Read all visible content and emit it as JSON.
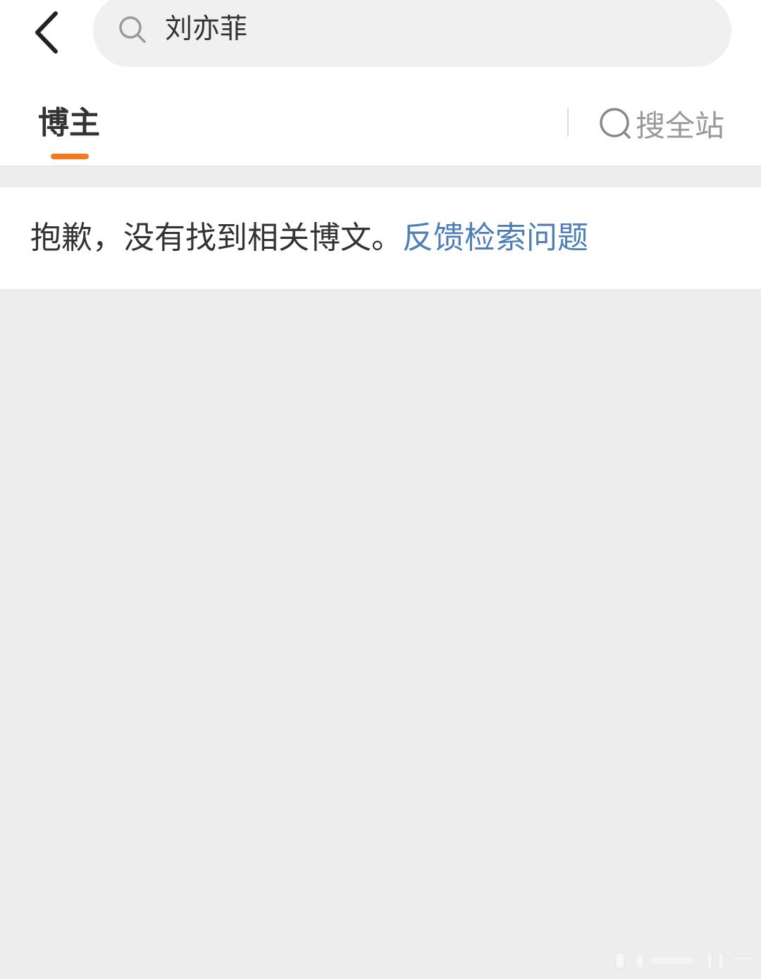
{
  "header": {
    "search_query": "刘亦菲"
  },
  "tabs": {
    "active_label": "博主",
    "search_all_label": "搜全站"
  },
  "notice": {
    "message": "抱歉，没有找到相关博文。",
    "feedback_link": "反馈检索问题"
  },
  "colors": {
    "accent_orange": "#f37a1f",
    "link_blue": "#4d7eb8",
    "background_gray": "#ededed"
  }
}
